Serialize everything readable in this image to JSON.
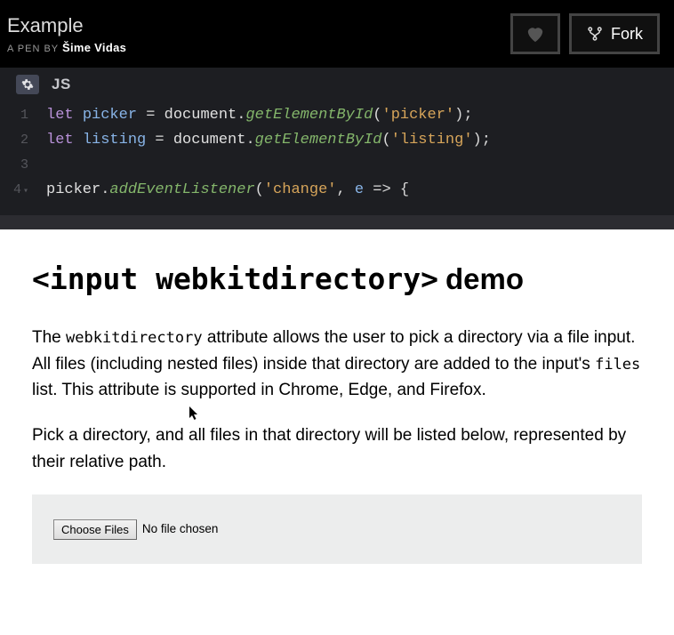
{
  "header": {
    "title": "Example",
    "byline_prefix": "A PEN BY",
    "author": "Šime Vidas",
    "fork_label": "Fork"
  },
  "editor": {
    "lang": "JS",
    "lines": [
      {
        "n": "1",
        "fold": false,
        "tokens": [
          {
            "t": "let ",
            "c": "kw"
          },
          {
            "t": "picker",
            "c": "id"
          },
          {
            "t": " = ",
            "c": "op"
          },
          {
            "t": "document",
            "c": "obj"
          },
          {
            "t": ".",
            "c": "punc"
          },
          {
            "t": "getElementById",
            "c": "fn"
          },
          {
            "t": "(",
            "c": "punc"
          },
          {
            "t": "'picker'",
            "c": "str"
          },
          {
            "t": ");",
            "c": "punc"
          }
        ]
      },
      {
        "n": "2",
        "fold": false,
        "tokens": [
          {
            "t": "let ",
            "c": "kw"
          },
          {
            "t": "listing",
            "c": "id"
          },
          {
            "t": " = ",
            "c": "op"
          },
          {
            "t": "document",
            "c": "obj"
          },
          {
            "t": ".",
            "c": "punc"
          },
          {
            "t": "getElementById",
            "c": "fn"
          },
          {
            "t": "(",
            "c": "punc"
          },
          {
            "t": "'listing'",
            "c": "str"
          },
          {
            "t": ");",
            "c": "punc"
          }
        ]
      },
      {
        "n": "3",
        "fold": false,
        "tokens": []
      },
      {
        "n": "4",
        "fold": true,
        "tokens": [
          {
            "t": "picker",
            "c": "obj"
          },
          {
            "t": ".",
            "c": "punc"
          },
          {
            "t": "addEventListener",
            "c": "fn"
          },
          {
            "t": "(",
            "c": "punc"
          },
          {
            "t": "'change'",
            "c": "str"
          },
          {
            "t": ", ",
            "c": "punc"
          },
          {
            "t": "e",
            "c": "id"
          },
          {
            "t": " => ",
            "c": "op"
          },
          {
            "t": "{",
            "c": "punc"
          }
        ]
      }
    ]
  },
  "demo": {
    "title_code": "<input webkitdirectory>",
    "title_word": "demo",
    "para1_a": "The ",
    "para1_code1": "webkitdirectory",
    "para1_b": " attribute allows the user to pick a directory via a file input. All files (including nested files) inside that directory are added to the input's ",
    "para1_code2": "files",
    "para1_c": " list. This attribute is supported in Chrome, Edge, and Firefox.",
    "para2": "Pick a directory, and all files in that directory will be listed below, represented by their relative path.",
    "choose_button": "Choose Files",
    "file_status": "No file chosen"
  }
}
